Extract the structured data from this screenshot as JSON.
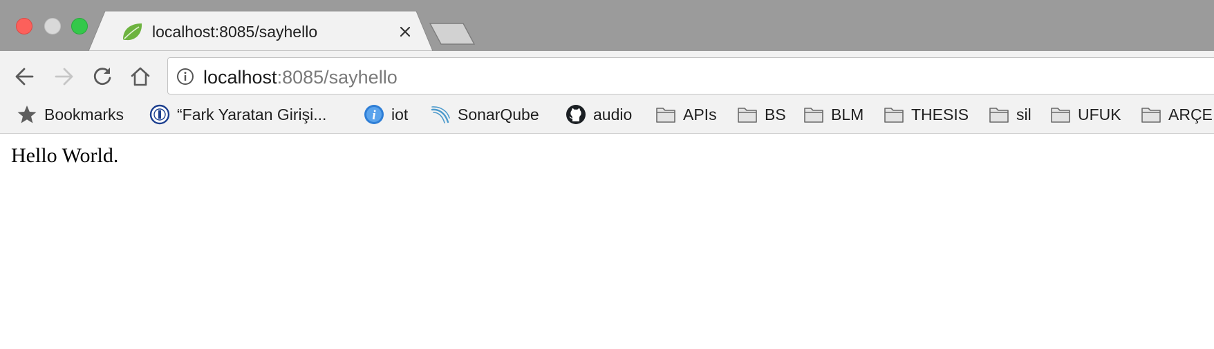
{
  "tab": {
    "title": "localhost:8085/sayhello",
    "close_glyph": "✕"
  },
  "window_controls": [
    "close",
    "minimize",
    "maximize"
  ],
  "navigation": {
    "back_icon": "arrow-left-icon",
    "forward_icon": "arrow-right-icon",
    "reload_icon": "reload-icon",
    "home_icon": "home-icon"
  },
  "address_bar": {
    "host": "localhost",
    "rest": ":8085/sayhello",
    "info_icon": "info-icon"
  },
  "bookmarks": {
    "label": "Bookmarks",
    "items": [
      {
        "label": "“Fark Yaratan Girişi...",
        "icon": "university-seal-icon"
      },
      {
        "label": "iot",
        "icon": "info-badge-icon"
      },
      {
        "label": "SonarQube",
        "icon": "sonarqube-icon"
      },
      {
        "label": "audio",
        "icon": "github-icon"
      },
      {
        "label": "APIs",
        "icon": "folder-icon"
      },
      {
        "label": "BS",
        "icon": "folder-icon"
      },
      {
        "label": "BLM",
        "icon": "folder-icon"
      },
      {
        "label": "THESIS",
        "icon": "folder-icon"
      },
      {
        "label": "sil",
        "icon": "folder-icon"
      },
      {
        "label": "UFUK",
        "icon": "folder-icon"
      },
      {
        "label": "ARÇE",
        "icon": "folder-icon"
      }
    ]
  },
  "page": {
    "body_text": "Hello World."
  },
  "colors": {
    "tabstrip": "#9b9b9b",
    "toolbar": "#f2f2f2",
    "close_light": "#fc605b",
    "max_light": "#34c84a",
    "spring_leaf": "#6db33f"
  }
}
